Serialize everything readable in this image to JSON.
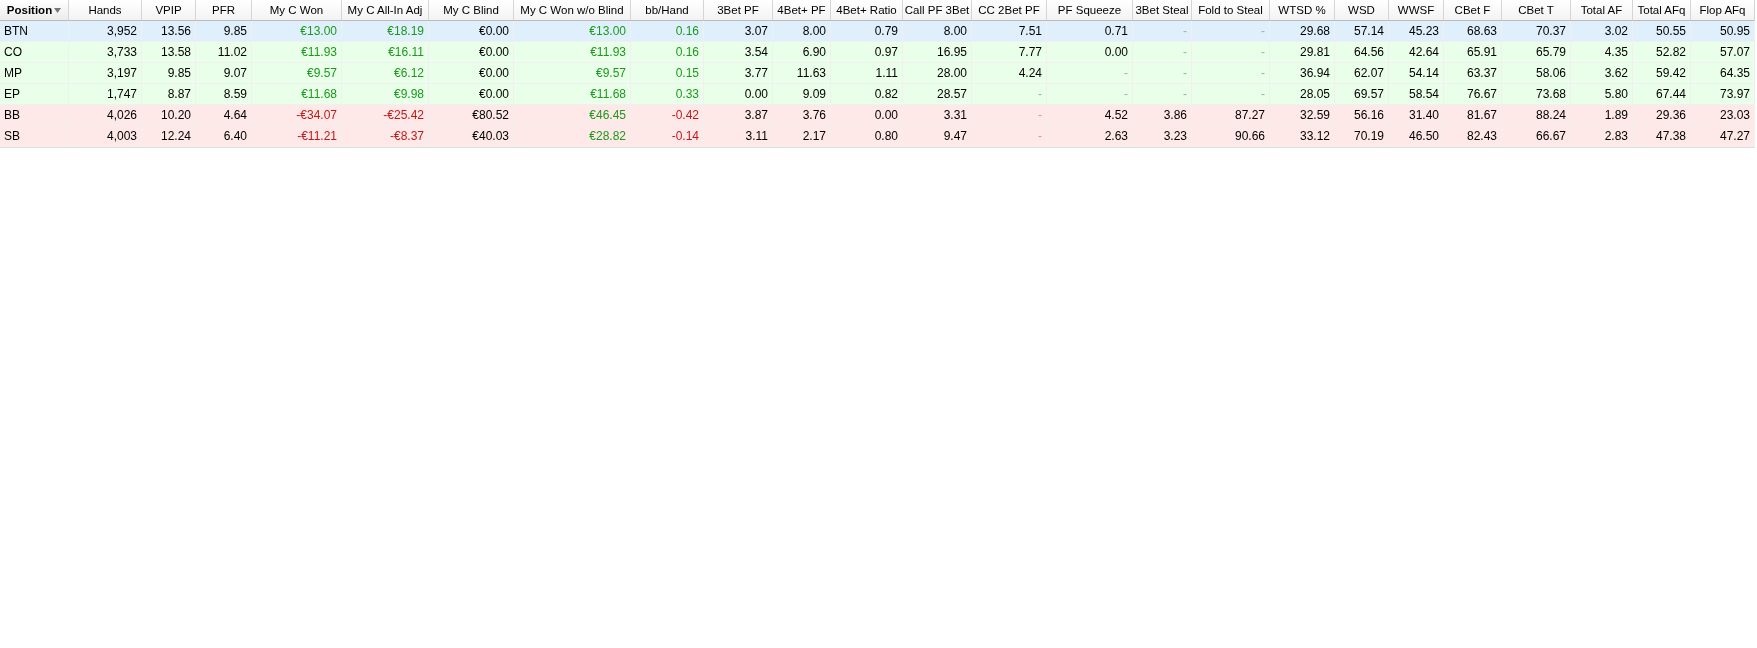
{
  "table": {
    "columns": [
      {
        "label": "Position",
        "sorted": true
      },
      {
        "label": "Hands",
        "sorted": false
      },
      {
        "label": "VPIP",
        "sorted": false
      },
      {
        "label": "PFR",
        "sorted": false
      },
      {
        "label": "My C Won",
        "sorted": false
      },
      {
        "label": "My C All-In Adj",
        "sorted": false
      },
      {
        "label": "My C Blind",
        "sorted": false
      },
      {
        "label": "My C Won w/o Blind",
        "sorted": false
      },
      {
        "label": "bb/Hand",
        "sorted": false
      },
      {
        "label": "3Bet PF",
        "sorted": false
      },
      {
        "label": "4Bet+ PF",
        "sorted": false
      },
      {
        "label": "4Bet+ Ratio",
        "sorted": false
      },
      {
        "label": "Call PF 3Bet",
        "sorted": false
      },
      {
        "label": "CC 2Bet PF",
        "sorted": false
      },
      {
        "label": "PF Squeeze",
        "sorted": false
      },
      {
        "label": "3Bet Steal",
        "sorted": false
      },
      {
        "label": "Fold to Steal",
        "sorted": false
      },
      {
        "label": "WTSD %",
        "sorted": false
      },
      {
        "label": "WSD",
        "sorted": false
      },
      {
        "label": "WWSF",
        "sorted": false
      },
      {
        "label": "CBet F",
        "sorted": false
      },
      {
        "label": "CBet T",
        "sorted": false
      },
      {
        "label": "Total AF",
        "sorted": false
      },
      {
        "label": "Total AFq",
        "sorted": false
      },
      {
        "label": "Flop AFq",
        "sorted": false
      }
    ],
    "rows": [
      {
        "color": "#dff0fc",
        "cells": [
          {
            "text": "BTN",
            "kind": "plain"
          },
          {
            "text": "3,952",
            "kind": "plain"
          },
          {
            "text": "13.56",
            "kind": "plain"
          },
          {
            "text": "9.85",
            "kind": "plain"
          },
          {
            "text": "€13.00",
            "kind": "gain"
          },
          {
            "text": "€18.19",
            "kind": "gain"
          },
          {
            "text": "€0.00",
            "kind": "plain"
          },
          {
            "text": "€13.00",
            "kind": "gain"
          },
          {
            "text": "0.16",
            "kind": "gain"
          },
          {
            "text": "3.07",
            "kind": "plain"
          },
          {
            "text": "8.00",
            "kind": "plain"
          },
          {
            "text": "0.79",
            "kind": "plain"
          },
          {
            "text": "8.00",
            "kind": "plain"
          },
          {
            "text": "7.51",
            "kind": "plain"
          },
          {
            "text": "0.71",
            "kind": "plain"
          },
          {
            "text": "-",
            "kind": "empty"
          },
          {
            "text": "-",
            "kind": "empty"
          },
          {
            "text": "29.68",
            "kind": "plain"
          },
          {
            "text": "57.14",
            "kind": "plain"
          },
          {
            "text": "45.23",
            "kind": "plain"
          },
          {
            "text": "68.63",
            "kind": "plain"
          },
          {
            "text": "70.37",
            "kind": "plain"
          },
          {
            "text": "3.02",
            "kind": "plain"
          },
          {
            "text": "50.55",
            "kind": "plain"
          },
          {
            "text": "50.95",
            "kind": "plain"
          }
        ]
      },
      {
        "color": "#eaffe9",
        "cells": [
          {
            "text": "CO",
            "kind": "plain"
          },
          {
            "text": "3,733",
            "kind": "plain"
          },
          {
            "text": "13.58",
            "kind": "plain"
          },
          {
            "text": "11.02",
            "kind": "plain"
          },
          {
            "text": "€11.93",
            "kind": "gain"
          },
          {
            "text": "€16.11",
            "kind": "gain"
          },
          {
            "text": "€0.00",
            "kind": "plain"
          },
          {
            "text": "€11.93",
            "kind": "gain"
          },
          {
            "text": "0.16",
            "kind": "gain"
          },
          {
            "text": "3.54",
            "kind": "plain"
          },
          {
            "text": "6.90",
            "kind": "plain"
          },
          {
            "text": "0.97",
            "kind": "plain"
          },
          {
            "text": "16.95",
            "kind": "plain"
          },
          {
            "text": "7.77",
            "kind": "plain"
          },
          {
            "text": "0.00",
            "kind": "plain"
          },
          {
            "text": "-",
            "kind": "empty"
          },
          {
            "text": "-",
            "kind": "empty"
          },
          {
            "text": "29.81",
            "kind": "plain"
          },
          {
            "text": "64.56",
            "kind": "plain"
          },
          {
            "text": "42.64",
            "kind": "plain"
          },
          {
            "text": "65.91",
            "kind": "plain"
          },
          {
            "text": "65.79",
            "kind": "plain"
          },
          {
            "text": "4.35",
            "kind": "plain"
          },
          {
            "text": "52.82",
            "kind": "plain"
          },
          {
            "text": "57.07",
            "kind": "plain"
          }
        ]
      },
      {
        "color": "#eaffe9",
        "cells": [
          {
            "text": "MP",
            "kind": "plain"
          },
          {
            "text": "3,197",
            "kind": "plain"
          },
          {
            "text": "9.85",
            "kind": "plain"
          },
          {
            "text": "9.07",
            "kind": "plain"
          },
          {
            "text": "€9.57",
            "kind": "gain"
          },
          {
            "text": "€6.12",
            "kind": "gain"
          },
          {
            "text": "€0.00",
            "kind": "plain"
          },
          {
            "text": "€9.57",
            "kind": "gain"
          },
          {
            "text": "0.15",
            "kind": "gain"
          },
          {
            "text": "3.77",
            "kind": "plain"
          },
          {
            "text": "11.63",
            "kind": "plain"
          },
          {
            "text": "1.11",
            "kind": "plain"
          },
          {
            "text": "28.00",
            "kind": "plain"
          },
          {
            "text": "4.24",
            "kind": "plain"
          },
          {
            "text": "-",
            "kind": "empty"
          },
          {
            "text": "-",
            "kind": "empty"
          },
          {
            "text": "-",
            "kind": "empty"
          },
          {
            "text": "36.94",
            "kind": "plain"
          },
          {
            "text": "62.07",
            "kind": "plain"
          },
          {
            "text": "54.14",
            "kind": "plain"
          },
          {
            "text": "63.37",
            "kind": "plain"
          },
          {
            "text": "58.06",
            "kind": "plain"
          },
          {
            "text": "3.62",
            "kind": "plain"
          },
          {
            "text": "59.42",
            "kind": "plain"
          },
          {
            "text": "64.35",
            "kind": "plain"
          }
        ]
      },
      {
        "color": "#eaffe9",
        "cells": [
          {
            "text": "EP",
            "kind": "plain"
          },
          {
            "text": "1,747",
            "kind": "plain"
          },
          {
            "text": "8.87",
            "kind": "plain"
          },
          {
            "text": "8.59",
            "kind": "plain"
          },
          {
            "text": "€11.68",
            "kind": "gain"
          },
          {
            "text": "€9.98",
            "kind": "gain"
          },
          {
            "text": "€0.00",
            "kind": "plain"
          },
          {
            "text": "€11.68",
            "kind": "gain"
          },
          {
            "text": "0.33",
            "kind": "gain"
          },
          {
            "text": "0.00",
            "kind": "plain"
          },
          {
            "text": "9.09",
            "kind": "plain"
          },
          {
            "text": "0.82",
            "kind": "plain"
          },
          {
            "text": "28.57",
            "kind": "plain"
          },
          {
            "text": "-",
            "kind": "empty"
          },
          {
            "text": "-",
            "kind": "empty"
          },
          {
            "text": "-",
            "kind": "empty"
          },
          {
            "text": "-",
            "kind": "empty"
          },
          {
            "text": "28.05",
            "kind": "plain"
          },
          {
            "text": "69.57",
            "kind": "plain"
          },
          {
            "text": "58.54",
            "kind": "plain"
          },
          {
            "text": "76.67",
            "kind": "plain"
          },
          {
            "text": "73.68",
            "kind": "plain"
          },
          {
            "text": "5.80",
            "kind": "plain"
          },
          {
            "text": "67.44",
            "kind": "plain"
          },
          {
            "text": "73.97",
            "kind": "plain"
          }
        ]
      },
      {
        "color": "#ffe8e8",
        "cells": [
          {
            "text": "BB",
            "kind": "plain"
          },
          {
            "text": "4,026",
            "kind": "plain"
          },
          {
            "text": "10.20",
            "kind": "plain"
          },
          {
            "text": "4.64",
            "kind": "plain"
          },
          {
            "text": "-€34.07",
            "kind": "loss"
          },
          {
            "text": "-€25.42",
            "kind": "loss"
          },
          {
            "text": "€80.52",
            "kind": "plain"
          },
          {
            "text": "€46.45",
            "kind": "gain"
          },
          {
            "text": "-0.42",
            "kind": "loss"
          },
          {
            "text": "3.87",
            "kind": "plain"
          },
          {
            "text": "3.76",
            "kind": "plain"
          },
          {
            "text": "0.00",
            "kind": "plain"
          },
          {
            "text": "3.31",
            "kind": "plain"
          },
          {
            "text": "-",
            "kind": "empty"
          },
          {
            "text": "4.52",
            "kind": "plain"
          },
          {
            "text": "3.86",
            "kind": "plain"
          },
          {
            "text": "87.27",
            "kind": "plain"
          },
          {
            "text": "32.59",
            "kind": "plain"
          },
          {
            "text": "56.16",
            "kind": "plain"
          },
          {
            "text": "31.40",
            "kind": "plain"
          },
          {
            "text": "81.67",
            "kind": "plain"
          },
          {
            "text": "88.24",
            "kind": "plain"
          },
          {
            "text": "1.89",
            "kind": "plain"
          },
          {
            "text": "29.36",
            "kind": "plain"
          },
          {
            "text": "23.03",
            "kind": "plain"
          }
        ]
      },
      {
        "color": "#ffe8e8",
        "cells": [
          {
            "text": "SB",
            "kind": "plain"
          },
          {
            "text": "4,003",
            "kind": "plain"
          },
          {
            "text": "12.24",
            "kind": "plain"
          },
          {
            "text": "6.40",
            "kind": "plain"
          },
          {
            "text": "-€11.21",
            "kind": "loss"
          },
          {
            "text": "-€8.37",
            "kind": "loss"
          },
          {
            "text": "€40.03",
            "kind": "plain"
          },
          {
            "text": "€28.82",
            "kind": "gain"
          },
          {
            "text": "-0.14",
            "kind": "loss"
          },
          {
            "text": "3.11",
            "kind": "plain"
          },
          {
            "text": "2.17",
            "kind": "plain"
          },
          {
            "text": "0.80",
            "kind": "plain"
          },
          {
            "text": "9.47",
            "kind": "plain"
          },
          {
            "text": "-",
            "kind": "empty"
          },
          {
            "text": "2.63",
            "kind": "plain"
          },
          {
            "text": "3.23",
            "kind": "plain"
          },
          {
            "text": "90.66",
            "kind": "plain"
          },
          {
            "text": "33.12",
            "kind": "plain"
          },
          {
            "text": "70.19",
            "kind": "plain"
          },
          {
            "text": "46.50",
            "kind": "plain"
          },
          {
            "text": "82.43",
            "kind": "plain"
          },
          {
            "text": "66.67",
            "kind": "plain"
          },
          {
            "text": "2.83",
            "kind": "plain"
          },
          {
            "text": "47.38",
            "kind": "plain"
          },
          {
            "text": "47.27",
            "kind": "plain"
          }
        ]
      }
    ]
  }
}
